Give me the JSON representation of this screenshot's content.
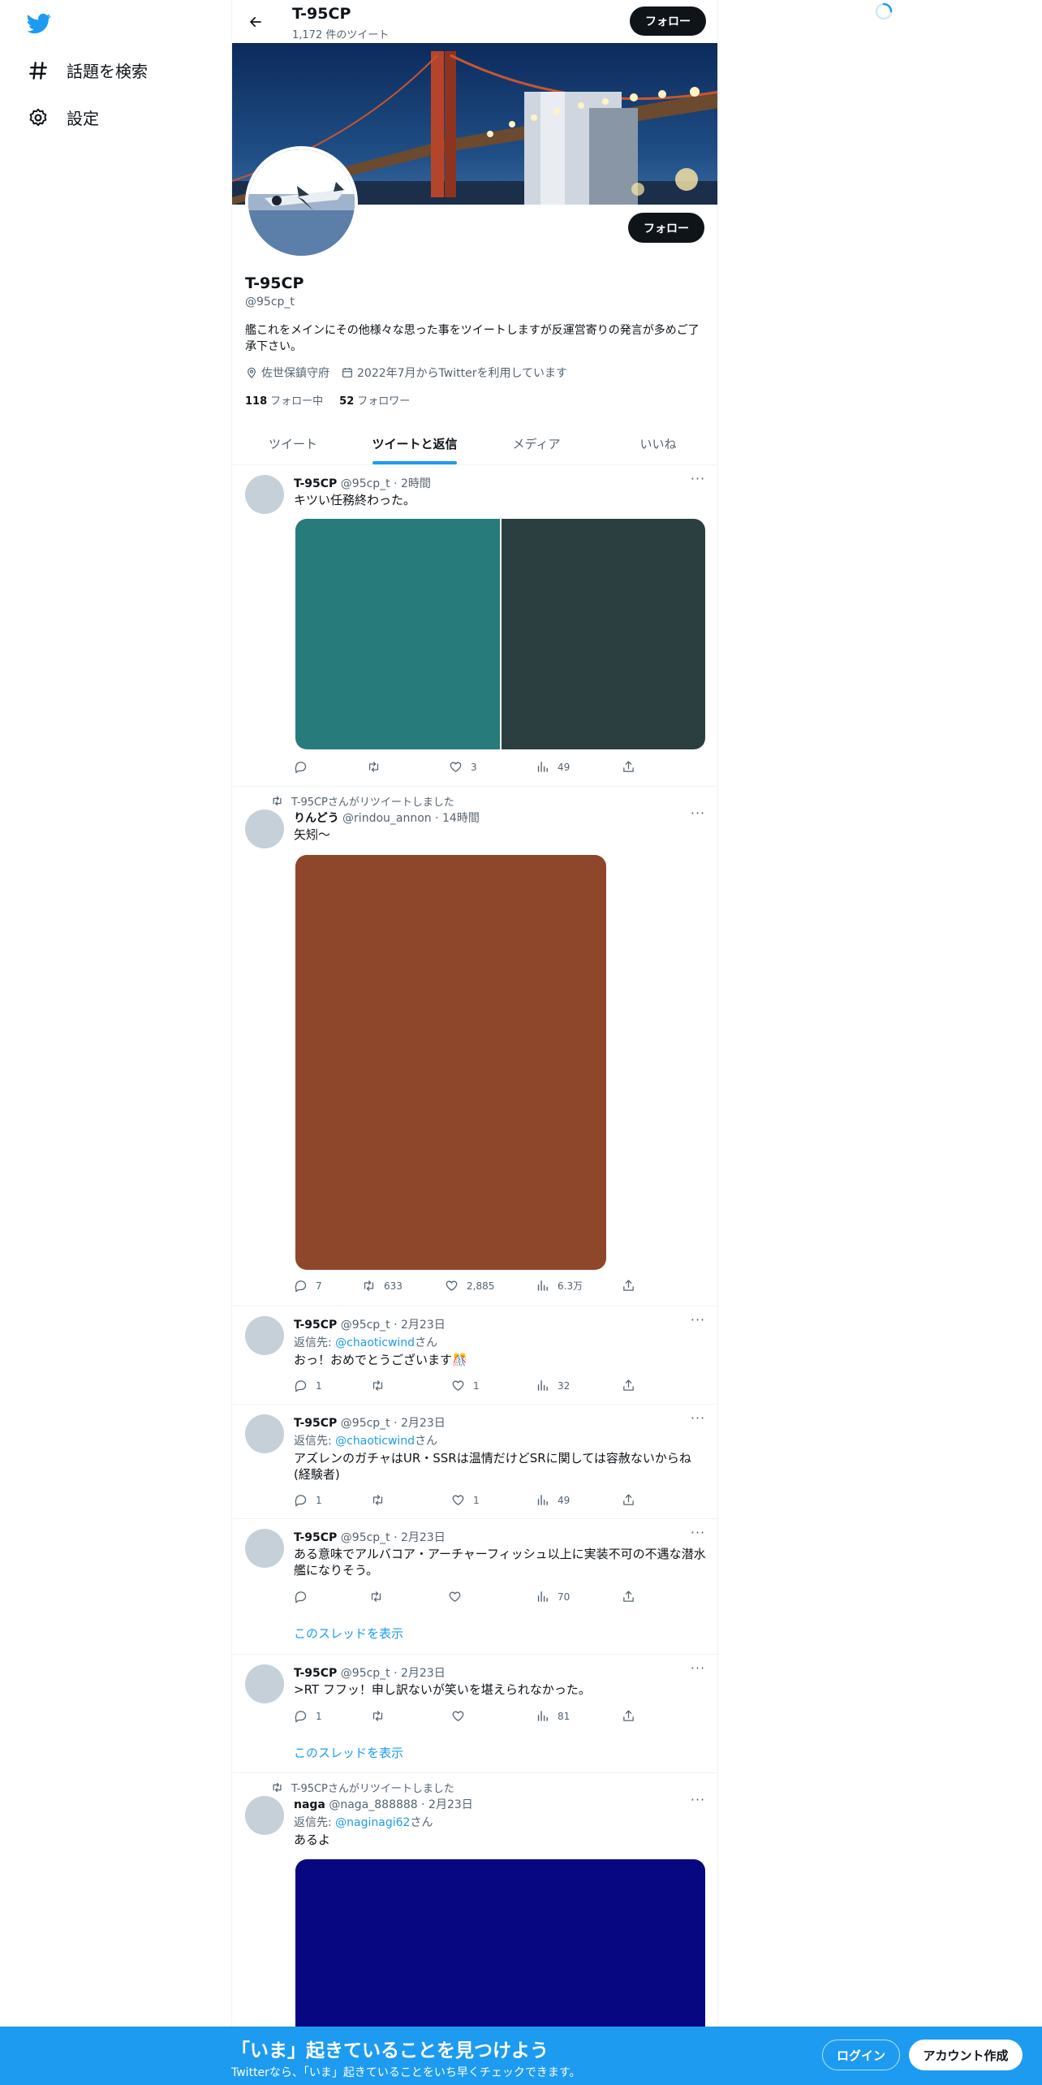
{
  "nav": {
    "items": [
      {
        "label": "話題を検索",
        "icon": "hashtag-icon"
      },
      {
        "label": "設定",
        "icon": "gear-icon"
      }
    ]
  },
  "header": {
    "name": "T-95CP",
    "tweet_count": "1,172 件のツイート",
    "follow_label": "フォロー"
  },
  "profile": {
    "display_name": "T-95CP",
    "handle": "@95cp_t",
    "bio": "艦これをメインにその他様々な思った事をツイートしますが反運営寄りの発言が多めご了承下さい。",
    "location": "佐世保鎮守府",
    "joined": "2022年7月からTwitterを利用しています",
    "following_count": "118",
    "following_label": "フォロー中",
    "followers_count": "52",
    "followers_label": "フォロワー",
    "follow_label": "フォロー"
  },
  "tabs": [
    {
      "label": "ツイート",
      "active": false
    },
    {
      "label": "ツイートと返信",
      "active": true
    },
    {
      "label": "メディア",
      "active": false
    },
    {
      "label": "いいね",
      "active": false
    }
  ],
  "tweets": [
    {
      "name": "T-95CP",
      "meta": "@95cp_t · 2時間",
      "text": "キツい任務終わった。",
      "reply": "",
      "likes": "3",
      "views": "49",
      "replies_count": "",
      "retweets": "",
      "media_colors": [
        "#277b7a",
        "#2b3e40"
      ]
    },
    {
      "retweet_by": "T-95CPさんがリツイートしました",
      "name": "りんどう",
      "meta": "@rindou_annon · 14時間",
      "text": "矢矧～",
      "replies_count": "7",
      "retweets": "633",
      "likes": "2,885",
      "views": "6.3万",
      "media_colors": [
        "#8e472a"
      ]
    },
    {
      "name": "T-95CP",
      "meta": "@95cp_t · 2月23日",
      "reply_prefix": "返信先: ",
      "reply_to": "@chaoticwind",
      "reply_suffix": "さん",
      "text": "おっ！おめでとうございます🎊",
      "replies_count": "1",
      "likes": "1",
      "views": "32"
    },
    {
      "name": "T-95CP",
      "meta": "@95cp_t · 2月23日",
      "reply_prefix": "返信先: ",
      "reply_to": "@chaoticwind",
      "reply_suffix": "さん",
      "text": "アズレンのガチャはUR・SSRは温情だけどSRに関しては容赦ないからね(経験者)",
      "replies_count": "1",
      "likes": "1",
      "views": "49"
    },
    {
      "name": "T-95CP",
      "meta": "@95cp_t · 2月23日",
      "text": "ある意味でアルバコア・アーチャーフィッシュ以上に実装不可の不遇な潜水艦になりそう。",
      "views": "70",
      "thread_link": "このスレッドを表示"
    },
    {
      "name": "T-95CP",
      "meta": "@95cp_t · 2月23日",
      "text": ">RT フフッ！申し訳ないが笑いを堪えられなかった。",
      "replies_count": "1",
      "views": "81",
      "thread_link": "このスレッドを表示"
    },
    {
      "retweet_by": "T-95CPさんがリツイートしました",
      "name": "naga",
      "meta": "@naga_888888 · 2月23日",
      "reply_prefix": "返信先: ",
      "reply_to": "@naginagi62",
      "reply_suffix": "さん",
      "text": "あるよ",
      "media_colors": [
        "#080782"
      ]
    }
  ],
  "bottom_bar": {
    "title": "「いま」起きていることを見つけよう",
    "subtitle": "Twitterなら、「いま」起きていることをいち早くチェックできます。",
    "login_label": "ログイン",
    "signup_label": "アカウント作成"
  },
  "colors": {
    "accent": "#1d9bf0",
    "bottom_bar": "#1d9bf0",
    "text": "#0f1419",
    "secondary_text": "#536471"
  }
}
